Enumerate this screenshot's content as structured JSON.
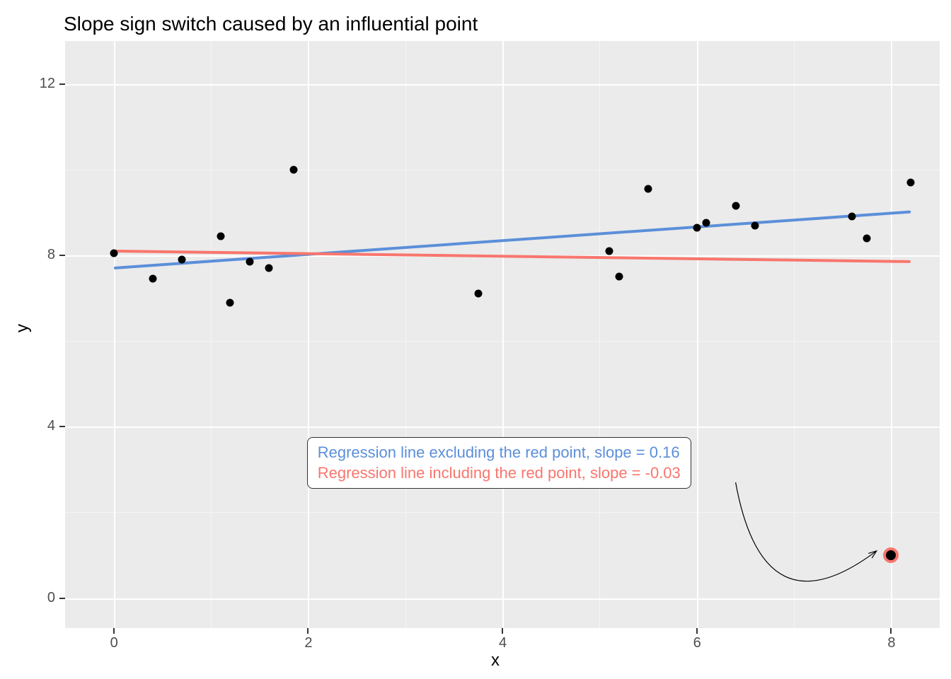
{
  "chart_data": {
    "type": "scatter",
    "title": "Slope sign switch caused by an influential point",
    "xlabel": "x",
    "ylabel": "y",
    "xlim": [
      -0.5,
      8.5
    ],
    "ylim": [
      -0.7,
      13.0
    ],
    "x_breaks": [
      0,
      2,
      4,
      6,
      8
    ],
    "y_breaks": [
      0,
      4,
      8,
      12
    ],
    "grid": true,
    "points": [
      {
        "x": 0.0,
        "y": 8.05
      },
      {
        "x": 0.4,
        "y": 7.45
      },
      {
        "x": 0.7,
        "y": 7.9
      },
      {
        "x": 1.1,
        "y": 8.45
      },
      {
        "x": 1.2,
        "y": 6.9
      },
      {
        "x": 1.4,
        "y": 7.85
      },
      {
        "x": 1.6,
        "y": 7.7
      },
      {
        "x": 1.85,
        "y": 10.0
      },
      {
        "x": 3.75,
        "y": 7.1
      },
      {
        "x": 5.1,
        "y": 8.1
      },
      {
        "x": 5.2,
        "y": 7.5
      },
      {
        "x": 5.5,
        "y": 9.55
      },
      {
        "x": 6.0,
        "y": 8.65
      },
      {
        "x": 6.1,
        "y": 8.75
      },
      {
        "x": 6.4,
        "y": 9.15
      },
      {
        "x": 6.6,
        "y": 8.7
      },
      {
        "x": 7.6,
        "y": 8.9
      },
      {
        "x": 7.75,
        "y": 8.4
      },
      {
        "x": 8.2,
        "y": 9.7
      }
    ],
    "outlier": {
      "x": 8.0,
      "y": 1.0
    },
    "series": [
      {
        "name": "excluding",
        "color": "#5B8FD9",
        "slope": 0.16,
        "intercept": 7.7,
        "label": "Regression line excluding the red point, slope = 0.16"
      },
      {
        "name": "including",
        "color": "#F8766D",
        "slope": -0.03,
        "intercept": 8.1,
        "label": "Regression line including the red point, slope = -0.03"
      }
    ],
    "annotations": {
      "box_x": 4.1,
      "box_y": 3.1
    },
    "arrow": {
      "from": {
        "x": 6.4,
        "y": 2.7
      },
      "to": {
        "x": 7.85,
        "y": 1.1
      }
    }
  }
}
